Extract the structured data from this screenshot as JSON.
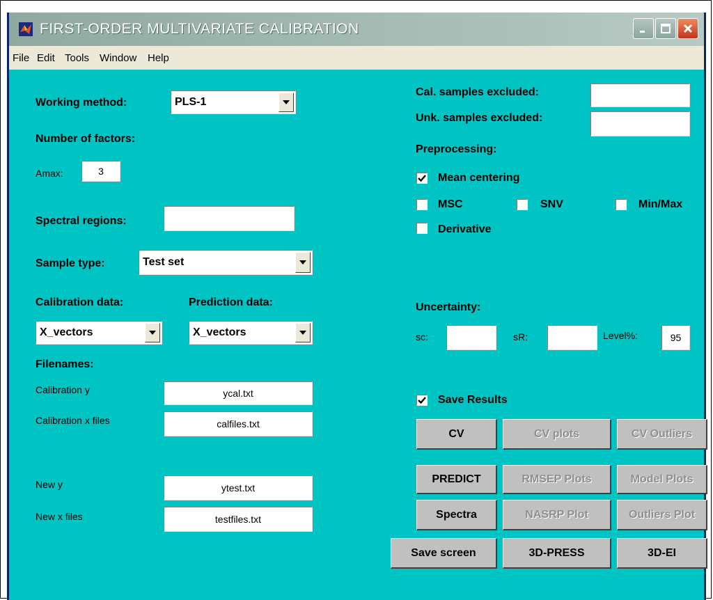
{
  "window": {
    "title": "FIRST-ORDER MULTIVARIATE CALIBRATION",
    "controls": {
      "minimize": "minimize-icon",
      "maximize": "maximize-icon",
      "close": "close-icon"
    }
  },
  "menu": [
    "File",
    "Edit",
    "Tools",
    "Window",
    "Help"
  ],
  "left": {
    "working_method_label": "Working method:",
    "working_method_value": "PLS-1",
    "factors_label": "Number of factors:",
    "amax_label": "Amax:",
    "amax_value": "3",
    "spectral_label": "Spectral regions:",
    "spectral_value": "",
    "sample_type_label": "Sample type:",
    "sample_type_value": "Test set",
    "calibration_data_label": "Calibration data:",
    "calibration_data_value": "X_vectors",
    "prediction_data_label": "Prediction data:",
    "prediction_data_value": "X_vectors",
    "filenames_label": "Filenames:",
    "cal_y_label": "Calibration y",
    "cal_y_value": "ycal.txt",
    "cal_x_label": "Calibration x files",
    "cal_x_value": "calfiles.txt",
    "new_y_label": "New y",
    "new_y_value": "ytest.txt",
    "new_x_label": "New x files",
    "new_x_value": "testfiles.txt"
  },
  "right": {
    "cal_excluded_label": "Cal. samples excluded:",
    "cal_excluded_value": "",
    "unk_excluded_label": "Unk. samples excluded:",
    "unk_excluded_value": "",
    "preprocessing_label": "Preprocessing:",
    "mean_centering_label": "Mean centering",
    "mean_centering_checked": true,
    "msc_label": "MSC",
    "snv_label": "SNV",
    "minmax_label": "Min/Max",
    "derivative_label": "Derivative",
    "uncertainty_label": "Uncertainty:",
    "sc_label": "sc:",
    "sc_value": "",
    "sr_label": "sR:",
    "sr_value": "",
    "level_label": "Level%:",
    "level_value": "95",
    "save_results_label": "Save Results",
    "save_results_checked": true
  },
  "buttons": {
    "cv": "CV",
    "cv_plots": "CV plots",
    "cv_outliers": "CV Outliers",
    "predict": "PREDICT",
    "rmsep_plots": "RMSEP Plots",
    "model_plots": "Model Plots",
    "spectra": "Spectra",
    "nasrp_plot": "NASRP Plot",
    "outliers_plot": "Outliers Plot",
    "save_screen": "Save screen",
    "press3d": "3D-PRESS",
    "ei3d": "3D-EI"
  },
  "colors": {
    "background": "#00c4c4",
    "button_face": "#c0c0c0",
    "titlebar": "#a7bdb5"
  }
}
